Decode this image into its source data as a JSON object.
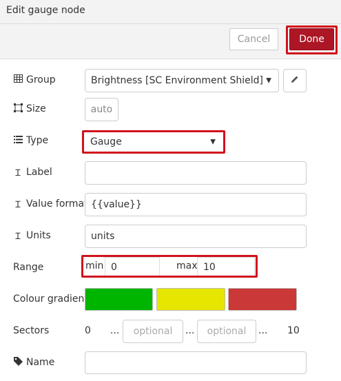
{
  "header": {
    "title": "Edit gauge node"
  },
  "toolbar": {
    "cancel_label": "Cancel",
    "done_label": "Done"
  },
  "form": {
    "group": {
      "label": "Group",
      "value": "Brightness [SC Environment Shield]",
      "icon": "table-icon",
      "edit_icon": "pencil-icon"
    },
    "size": {
      "label": "Size",
      "value": "auto",
      "icon": "resize-icon"
    },
    "type": {
      "label": "Type",
      "value": "Gauge",
      "icon": "list-icon"
    },
    "label_field": {
      "label": "Label",
      "value": "",
      "icon": "text-cursor-icon"
    },
    "value_format": {
      "label": "Value format",
      "value": "{{value}}",
      "icon": "text-cursor-icon"
    },
    "units": {
      "label": "Units",
      "value": "units",
      "icon": "text-cursor-icon"
    },
    "range": {
      "label": "Range",
      "min_label": "min",
      "min_value": "0",
      "max_label": "max",
      "max_value": "10"
    },
    "colour_gradient": {
      "label": "Colour gradient",
      "colors": [
        "#00b500",
        "#e6e600",
        "#ca3838"
      ]
    },
    "sectors": {
      "label": "Sectors",
      "start": "0",
      "sep1": "...",
      "placeholder1": "optional",
      "sep2": "...",
      "placeholder2": "optional",
      "sep3": "...",
      "end": "10"
    },
    "name": {
      "label": "Name",
      "value": "",
      "icon": "tag-icon"
    }
  },
  "highlight_color": "#d0111b"
}
